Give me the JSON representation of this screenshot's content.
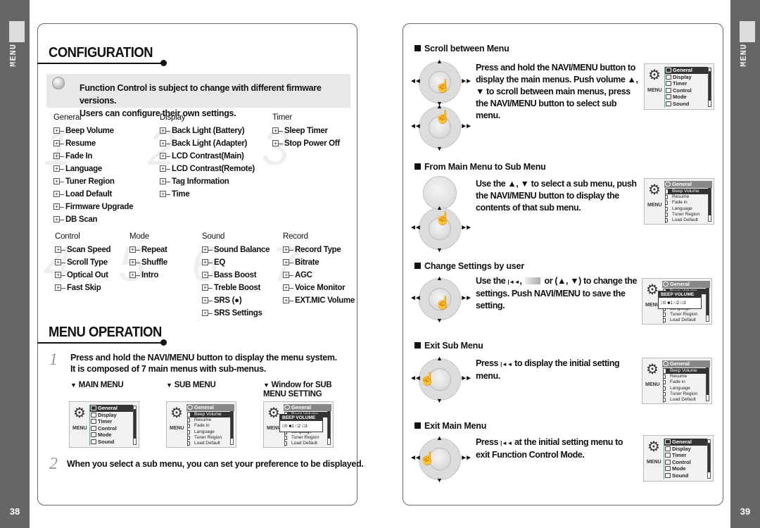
{
  "side_tabs": {
    "left": {
      "label": "MENU",
      "page_number": "38"
    },
    "right": {
      "label": "MENU",
      "page_number": "39"
    }
  },
  "configuration": {
    "title": "CONFIGURATION",
    "note": {
      "icon": "magnifier-icon",
      "line1": "Function Control is subject to change with different firmware versions.",
      "line2": "Users can configure their own settings."
    },
    "menus": [
      {
        "number": "1",
        "title": "General",
        "items": [
          "Beep Volume",
          "Resume",
          "Fade In",
          "Language",
          "Tuner Region",
          "Load Default",
          "Firmware Upgrade",
          "DB  Scan"
        ]
      },
      {
        "number": "2",
        "title": "Display",
        "items": [
          "Back Light (Battery)",
          "Back Light (Adapter)",
          "LCD Contrast(Main)",
          "LCD Contrast(Remote)",
          "Tag Information",
          "Time"
        ]
      },
      {
        "number": "3",
        "title": "Timer",
        "items": [
          "Sleep Timer",
          "Stop Power Off"
        ]
      },
      {
        "number": "4",
        "title": "Control",
        "items": [
          "Scan Speed",
          "Scroll Type",
          "Optical Out",
          "Fast Skip"
        ]
      },
      {
        "number": "5",
        "title": "Mode",
        "items": [
          "Repeat",
          "Shuffle",
          "Intro"
        ]
      },
      {
        "number": "6",
        "title": "Sound",
        "items": [
          "Sound Balance",
          "EQ",
          "Bass Boost",
          "Treble Boost",
          "SRS (●)",
          "SRS Settings"
        ]
      },
      {
        "number": "7",
        "title": "Record",
        "items": [
          "Record Type",
          "Bitrate",
          "AGC",
          "Voice Monitor",
          "EXT.MIC Volume"
        ]
      }
    ]
  },
  "menu_operation": {
    "title": "MENU OPERATION",
    "step1": {
      "number": "1",
      "line1": "Press and hold the NAVI/MENU button to display the menu system.",
      "line2": "It is composed of 7 main menus with sub-menus."
    },
    "captions": [
      "MAIN MENU",
      "SUB MENU",
      "Window for SUB MENU SETTING"
    ],
    "step2": {
      "number": "2",
      "text": "When you select a sub menu, you can set your preference to be displayed."
    }
  },
  "lcd": {
    "menu_label": "MENU",
    "main_menu_items": [
      "General",
      "Display",
      "Timer",
      "Control",
      "Mode",
      "Sound"
    ],
    "sub_menu_header": "General",
    "sub_menu_items": [
      "Beep Volume",
      "Resume",
      "Fade in",
      "Language",
      "Tuner Region",
      "Load Default"
    ],
    "popup_title": "BEEP VOLUME",
    "popup_options": "□0  ■1  □2  □3",
    "popup_selected": "1"
  },
  "right_page": {
    "sections": [
      {
        "title": "Scroll between Menu",
        "text": "Press and hold the NAVI/MENU button to display the main menus. Push volume ▲, ▼ to scroll between main menus, press the NAVI/MENU button to select sub menu."
      },
      {
        "title": "From Main Menu to Sub Menu",
        "text": "Use the ▲, ▼ to select a sub menu, push the NAVI/MENU button to display the contents of that sub menu."
      },
      {
        "title": "Change Settings by user",
        "text_a": "Use the",
        "text_b": "or (▲, ▼) to change the settings.  Push NAVI/MENU to save the setting."
      },
      {
        "title": "Exit Sub Menu",
        "text_a": "Press",
        "text_b": "to display the initial setting menu."
      },
      {
        "title": "Exit Main Menu",
        "text_a": "Press",
        "text_b": "at the initial setting menu to exit Function Control Mode."
      }
    ]
  },
  "glyphs": {
    "up": "▲",
    "down": "▼",
    "prev": "◄◄",
    "next": "►►",
    "hand": "☝",
    "gear": "⚙",
    "plus": "+",
    "prev_inline": "|◄◄"
  }
}
